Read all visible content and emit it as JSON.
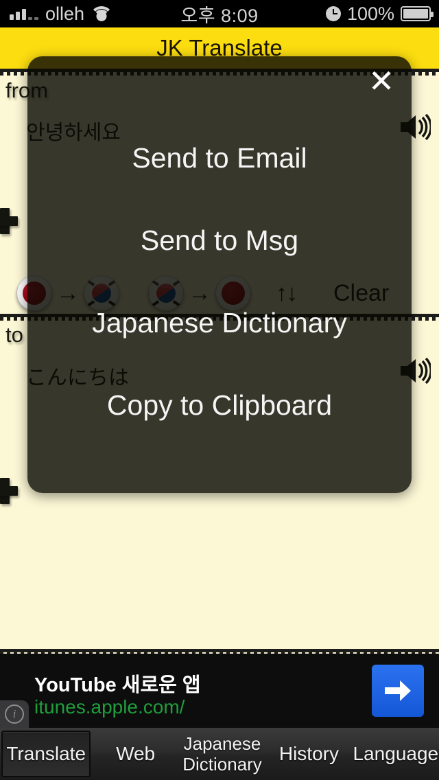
{
  "status_bar": {
    "carrier": "olleh",
    "time": "오후 8:09",
    "battery_percent": "100%",
    "signal_icon": "signal-bars-icon",
    "wifi_icon": "wifi-icon",
    "clock_icon": "alarm-clock-icon",
    "battery_icon": "battery-full-icon"
  },
  "title_bar": {
    "title": "JK Translate",
    "background_color": "#FCDD10"
  },
  "translate": {
    "from_label": "from",
    "from_text": "안녕하세요",
    "to_label": "to",
    "to_text": "こんにちは",
    "speaker_icon": "speaker-icon",
    "plus_icon": "plus-icon",
    "background_color": "#FCF7D5"
  },
  "language_toolbar": {
    "jp_to_kr_label": "japanese-to-korean",
    "kr_to_jp_label": "korean-to-japanese",
    "arrow": "→",
    "swap_label": "↑↓",
    "clear_label": "Clear"
  },
  "modal": {
    "close_label": "✕",
    "background_color": "#35332B",
    "items": [
      {
        "label": "Send to Email"
      },
      {
        "label": "Send to Msg"
      },
      {
        "label": "Japanese Dictionary"
      },
      {
        "label": "Copy to Clipboard"
      }
    ]
  },
  "ad": {
    "title": "YouTube 새로운 앱",
    "url": "itunes.apple.com/",
    "url_color": "#1f9e3c",
    "go_icon": "arrow-right-icon",
    "info_icon": "info-icon",
    "info_label": "i"
  },
  "tabs": [
    {
      "label": "Translate",
      "selected": true
    },
    {
      "label": "Web",
      "selected": false
    },
    {
      "label": "Japanese",
      "label2": "Dictionary",
      "selected": false
    },
    {
      "label": "History",
      "selected": false
    },
    {
      "label": "Language",
      "selected": false
    }
  ]
}
